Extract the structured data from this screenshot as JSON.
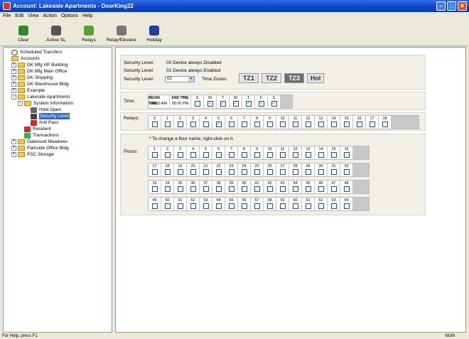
{
  "window": {
    "title": "Account: Lakeside Apartments - DoorKing32"
  },
  "menu": [
    "File",
    "Edit",
    "View",
    "Action",
    "Options",
    "Help"
  ],
  "toolbar": [
    {
      "label": "Clear",
      "icon": "clear-icon",
      "color": "#2f8a2f"
    },
    {
      "label": "Active SL",
      "icon": "active-sl-icon",
      "color": "#555555"
    },
    {
      "label": "Relays",
      "icon": "relays-icon",
      "color": "#5aa02c"
    },
    {
      "label": "Relay/Elevator",
      "icon": "elevator-icon",
      "color": "#777777"
    },
    {
      "label": "Holiday",
      "icon": "holiday-icon",
      "color": "#1f3fa8"
    }
  ],
  "tree": [
    {
      "label": "Scheduled Transfers",
      "depth": 0,
      "icon": "clock-icon"
    },
    {
      "label": "Accounts",
      "depth": 0,
      "icon": "folder-icon"
    },
    {
      "label": "DK Mfg HP Building",
      "depth": 1,
      "icon": "folder-icon",
      "exp": "+"
    },
    {
      "label": "DK Mfg Main Office",
      "depth": 1,
      "icon": "folder-icon",
      "exp": "+"
    },
    {
      "label": "DK Shipping",
      "depth": 1,
      "icon": "folder-icon",
      "exp": "+"
    },
    {
      "label": "DK Warehouse Bldg",
      "depth": 1,
      "icon": "folder-icon",
      "exp": "+"
    },
    {
      "label": "Example",
      "depth": 1,
      "icon": "folder-icon",
      "exp": "+"
    },
    {
      "label": "Lakeside Apartments",
      "depth": 1,
      "icon": "folder-icon",
      "exp": "-"
    },
    {
      "label": "System Information",
      "depth": 2,
      "icon": "folder-icon",
      "exp": "-"
    },
    {
      "label": "Hold Open",
      "depth": 3,
      "icon": "hold-open-icon"
    },
    {
      "label": "Security Level",
      "depth": 3,
      "icon": "security-level-icon",
      "selected": true
    },
    {
      "label": "Anti Pass",
      "depth": 3,
      "icon": "anti-pass-icon"
    },
    {
      "label": "Resident",
      "depth": 2,
      "icon": "resident-icon"
    },
    {
      "label": "Transactions",
      "depth": 2,
      "icon": "transactions-icon"
    },
    {
      "label": "Oakwood Meadows",
      "depth": 1,
      "icon": "folder-icon",
      "exp": "+"
    },
    {
      "label": "Parkside Office Bldg",
      "depth": 1,
      "icon": "folder-icon",
      "exp": "+"
    },
    {
      "label": "PSC Storage",
      "depth": 1,
      "icon": "folder-icon",
      "exp": "+"
    }
  ],
  "security": {
    "label": "Security Level:",
    "line1": "00 Device always Disabled",
    "line2": "01 Device always Enabled",
    "selected": "02",
    "tz_label": "Time Zones:",
    "timezones": [
      {
        "label": "TZ1",
        "active": false
      },
      {
        "label": "TZ2",
        "active": false
      },
      {
        "label": "TZ3",
        "active": true
      },
      {
        "label": "Hol",
        "active": false
      }
    ]
  },
  "time": {
    "label": "Time:",
    "begin_label": "BEGIN TIME",
    "end_label": "END TIME",
    "begin": "09:00 AM",
    "end": "05:00 PM",
    "days": [
      {
        "label": "S",
        "checked": false
      },
      {
        "label": "M",
        "checked": true
      },
      {
        "label": "T",
        "checked": true
      },
      {
        "label": "W",
        "checked": true
      },
      {
        "label": "T",
        "checked": true
      },
      {
        "label": "F",
        "checked": true
      },
      {
        "label": "S",
        "checked": true
      }
    ]
  },
  "relays": {
    "label": "Relays:",
    "items": [
      "0",
      "1",
      "2",
      "3",
      "4",
      "5",
      "6",
      "7",
      "8",
      "9",
      "10",
      "11",
      "12",
      "13",
      "14",
      "15",
      "16",
      "17",
      "18"
    ],
    "checked": [
      "5"
    ]
  },
  "floors": {
    "note": "* To change a floor name, right-click on it.",
    "label": "Floors:",
    "rows": [
      [
        "1",
        "2",
        "3",
        "4",
        "5",
        "6",
        "7",
        "8",
        "9",
        "10",
        "11",
        "12",
        "13",
        "14",
        "15",
        "16"
      ],
      [
        "17",
        "18",
        "19",
        "20",
        "21",
        "22",
        "23",
        "24",
        "25",
        "26",
        "27",
        "28",
        "29",
        "30",
        "31",
        "32"
      ],
      [
        "33",
        "34",
        "35",
        "36",
        "37",
        "38",
        "39",
        "40",
        "41",
        "42",
        "43",
        "44",
        "45",
        "46",
        "47",
        "48"
      ],
      [
        "49",
        "50",
        "51",
        "52",
        "53",
        "54",
        "55",
        "56",
        "57",
        "58",
        "59",
        "60",
        "61",
        "62",
        "63",
        "64"
      ]
    ]
  },
  "status": {
    "help": "For Help, press F1",
    "num": "NUM"
  }
}
